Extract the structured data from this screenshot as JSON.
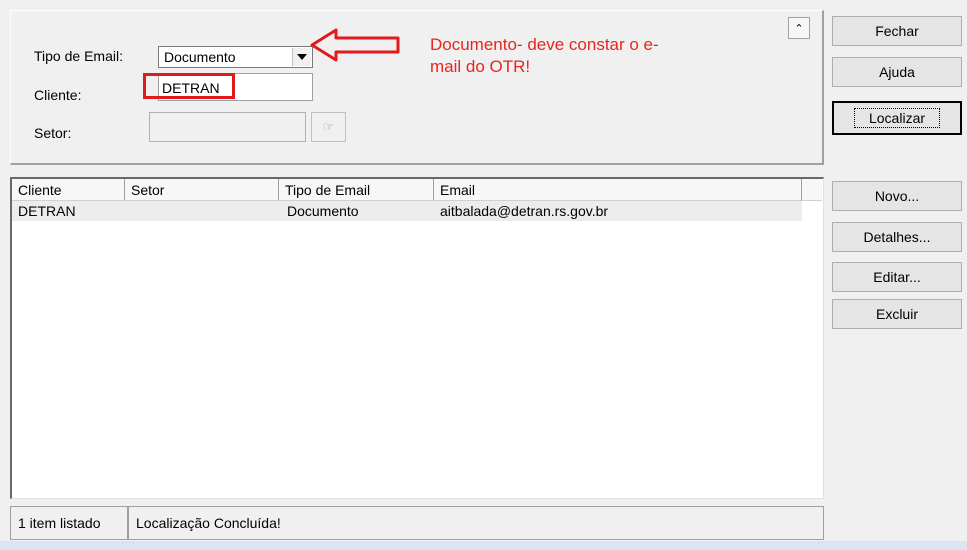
{
  "filters": {
    "tipo_email_label": "Tipo de Email:",
    "tipo_email_value": "Documento",
    "cliente_label": "Cliente:",
    "cliente_value": "DETRAN",
    "setor_label": "Setor:",
    "setor_value": ""
  },
  "annotation": {
    "text": "Documento- deve constar o e-mail do OTR!",
    "color": "#e8261f"
  },
  "buttons": {
    "fechar": "Fechar",
    "ajuda": "Ajuda",
    "localizar": "Localizar",
    "novo": "Novo...",
    "detalhes": "Detalhes...",
    "editar": "Editar...",
    "excluir": "Excluir"
  },
  "list": {
    "columns": [
      "Cliente",
      "Setor",
      "Tipo de Email",
      "Email"
    ],
    "rows": [
      [
        "DETRAN",
        "",
        "Documento",
        "aitbalada@detran.rs.gov.br"
      ]
    ]
  },
  "status": {
    "count": "1 item listado",
    "message": "Localização Concluída!"
  },
  "colors": {
    "highlight": "#e11b1b",
    "background": "#f0f0f0"
  }
}
